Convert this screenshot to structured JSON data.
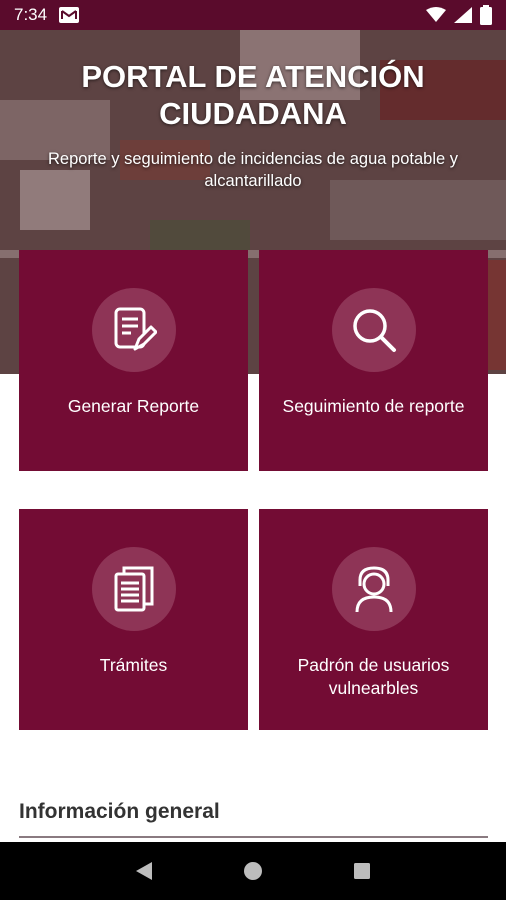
{
  "status_bar": {
    "time": "7:34",
    "icons": [
      "mail-icon",
      "wifi-icon",
      "signal-icon",
      "battery-icon"
    ]
  },
  "hero": {
    "title": "PORTAL DE ATENCIÓN CIUDADANA",
    "subtitle": "Reporte y seguimiento de incidencias de agua potable y alcantarillado"
  },
  "cards": [
    {
      "label": "Generar Reporte",
      "icon": "edit-document-icon"
    },
    {
      "label": "Seguimiento de reporte",
      "icon": "search-icon"
    },
    {
      "label": "Trámites",
      "icon": "documents-icon"
    },
    {
      "label": "Padrón de usuarios vulnearbles",
      "icon": "user-headset-icon"
    }
  ],
  "section": {
    "title": "Información general"
  },
  "nav_bar": {
    "buttons": [
      "back-icon",
      "home-icon",
      "recents-icon"
    ]
  },
  "colors": {
    "primary": "#730c34",
    "status_bar": "#5a0b2c",
    "icon_circle": "#8e3456",
    "nav_bar": "#000000"
  }
}
